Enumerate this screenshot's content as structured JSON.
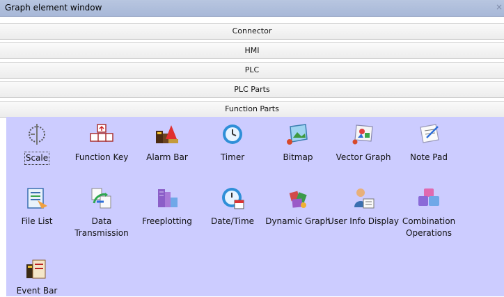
{
  "window": {
    "title": "Graph element window",
    "close_glyph": "×"
  },
  "sections": [
    "Connector",
    "HMI",
    "PLC",
    "PLC Parts",
    "Function Parts"
  ],
  "items": [
    {
      "label": "Scale",
      "icon": "scale-icon"
    },
    {
      "label": "Function Key",
      "icon": "function-key-icon"
    },
    {
      "label": "Alarm Bar",
      "icon": "alarm-bar-icon"
    },
    {
      "label": "Timer",
      "icon": "timer-icon"
    },
    {
      "label": "Bitmap",
      "icon": "bitmap-icon"
    },
    {
      "label": "Vector Graph",
      "icon": "vector-graph-icon"
    },
    {
      "label": "Note Pad",
      "icon": "note-pad-icon"
    },
    {
      "label": "File List",
      "icon": "file-list-icon"
    },
    {
      "label": "Data Transmission",
      "icon": "data-transmission-icon"
    },
    {
      "label": "Freeplotting",
      "icon": "freeplotting-icon"
    },
    {
      "label": "Date/Time",
      "icon": "date-time-icon"
    },
    {
      "label": "Dynamic Graph",
      "icon": "dynamic-graph-icon"
    },
    {
      "label": "User Info Display",
      "icon": "user-info-display-icon"
    },
    {
      "label": "Combination Operations",
      "icon": "combination-operations-icon"
    },
    {
      "label": "Event Bar",
      "icon": "event-bar-icon"
    }
  ],
  "selected_item": "Scale"
}
